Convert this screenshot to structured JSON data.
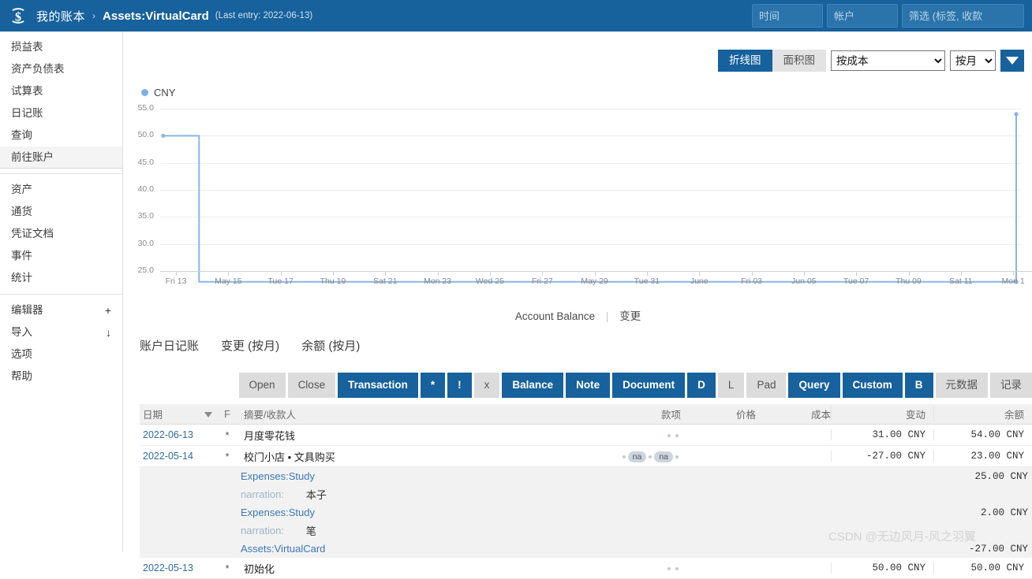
{
  "topbar": {
    "logo_icon": "fava-dollar-icon",
    "book_name": "我的账本",
    "separator": "›",
    "account": "Assets:VirtualCard",
    "last_entry": "(Last entry: 2022-06-13)",
    "inputs": [
      {
        "name": "time",
        "placeholder": "时间",
        "value": ""
      },
      {
        "name": "account",
        "placeholder": "帐户",
        "value": ""
      },
      {
        "name": "filter",
        "placeholder": "筛选 (标签, 收款",
        "value": ""
      }
    ],
    "bg_color": "#17619c"
  },
  "sidebar": {
    "groups": [
      {
        "items": [
          {
            "label": "损益表",
            "active": false
          },
          {
            "label": "资产负债表",
            "active": false
          },
          {
            "label": "试算表",
            "active": false
          },
          {
            "label": "日记账",
            "active": false
          },
          {
            "label": "查询",
            "active": false
          },
          {
            "label": "前往账户",
            "active": true
          }
        ]
      },
      {
        "items": [
          {
            "label": "资产",
            "active": false
          },
          {
            "label": "通货",
            "active": false
          },
          {
            "label": "凭证文档",
            "active": false
          },
          {
            "label": "事件",
            "active": false
          },
          {
            "label": "统计",
            "active": false
          }
        ]
      },
      {
        "items": [
          {
            "label": "编辑器",
            "sup": "+",
            "active": false
          },
          {
            "label": "导入",
            "sup": "↓",
            "active": false
          },
          {
            "label": "选项",
            "active": false
          },
          {
            "label": "帮助",
            "active": false
          }
        ]
      }
    ]
  },
  "chart_toolbar": {
    "line_button": "折线图",
    "area_button": "面积图",
    "mode_select": {
      "value": "按成本",
      "options": [
        "按成本"
      ]
    },
    "period_select": {
      "value": "按月",
      "options": [
        "按月"
      ]
    },
    "toggle_icon": "triangle-down-icon",
    "accent_color": "#17619c"
  },
  "chart_data": {
    "type": "line",
    "title": "",
    "legend": [
      "CNY"
    ],
    "legend_position": "top-left",
    "legend_color": "#7aaee8",
    "line_color": "#8ab4e8",
    "grid": true,
    "xlabel": "",
    "ylabel": "",
    "ylim": [
      23,
      55
    ],
    "yticks": [
      "55.0",
      "50.0",
      "45.0",
      "40.0",
      "35.0",
      "30.0",
      "25.0"
    ],
    "ytick_values": [
      55.0,
      50.0,
      45.0,
      40.0,
      35.0,
      30.0,
      25.0
    ],
    "xticks": [
      "Fri 13",
      "May 15",
      "Tue 17",
      "Thu 19",
      "Sat 21",
      "Mon 23",
      "Wed 25",
      "Fri 27",
      "May 29",
      "Tue 31",
      "June",
      "Fri 03",
      "Jun 05",
      "Tue 07",
      "Thu 09",
      "Sat 11",
      "Mon 1"
    ],
    "series": [
      {
        "name": "CNY",
        "x": [
          "2022-05-13",
          "2022-05-14",
          "2022-06-13",
          "2022-06-13"
        ],
        "values": [
          50.0,
          50.0,
          23.0,
          54.0
        ]
      }
    ]
  },
  "chart_caption": {
    "balance_label": "Account Balance",
    "divider": "|",
    "change_label": "变更"
  },
  "journal_tabs": [
    {
      "label": "账户日记账"
    },
    {
      "label": "变更 (按月)"
    },
    {
      "label": "余额 (按月)"
    }
  ],
  "operations": [
    {
      "label": "Open",
      "style": "gray"
    },
    {
      "label": "Close",
      "style": "gray"
    },
    {
      "label": "Transaction",
      "style": "blue"
    },
    {
      "label": "*",
      "style": "blue"
    },
    {
      "label": "!",
      "style": "blue"
    },
    {
      "label": "x",
      "style": "gray"
    },
    {
      "label": "Balance",
      "style": "blue"
    },
    {
      "label": "Note",
      "style": "blue"
    },
    {
      "label": "Document",
      "style": "blue"
    },
    {
      "label": "D",
      "style": "blue"
    },
    {
      "label": "L",
      "style": "gray"
    },
    {
      "label": "Pad",
      "style": "gray"
    },
    {
      "label": "Query",
      "style": "blue"
    },
    {
      "label": "Custom",
      "style": "blue"
    },
    {
      "label": "B",
      "style": "blue"
    },
    {
      "label": "元数据",
      "style": "gray"
    },
    {
      "label": "记录",
      "style": "gray"
    }
  ],
  "table": {
    "headers": {
      "date": "日期",
      "sort_icon": "sort-desc-icon",
      "flag": "F",
      "narration": "摘要/收款人",
      "units": "款项",
      "price": "价格",
      "cost": "成本",
      "change": "变动",
      "balance": "余额"
    },
    "rows": [
      {
        "date": "2022-06-13",
        "flag": "*",
        "narration": "月度零花钱",
        "payee": "",
        "units_markers": "dots-2",
        "change": "31.00 CNY",
        "balance": "54.00 CNY",
        "alt": false,
        "postings": []
      },
      {
        "date": "2022-05-14",
        "flag": "*",
        "narration": "校门小店 • 文具购买",
        "payee": "校门小店",
        "units_markers": "na-na",
        "change": "-27.00 CNY",
        "balance": "23.00 CNY",
        "alt": false,
        "postings": [
          {
            "account": "Expenses:Study",
            "amount": "25.00 CNY"
          },
          {
            "narration_key": "narration:",
            "narration_value": "本子"
          },
          {
            "account": "Expenses:Study",
            "amount": "2.00 CNY"
          },
          {
            "narration_key": "narration:",
            "narration_value": "笔"
          },
          {
            "account": "Assets:VirtualCard",
            "amount": "-27.00 CNY"
          }
        ]
      },
      {
        "date": "2022-05-13",
        "flag": "*",
        "narration": "初始化",
        "payee": "",
        "units_markers": "dots-2",
        "change": "50.00 CNY",
        "balance": "50.00 CNY",
        "alt": false,
        "postings": []
      }
    ],
    "na_label": "na"
  },
  "watermark": "CSDN @无边风月-风之羽翼"
}
